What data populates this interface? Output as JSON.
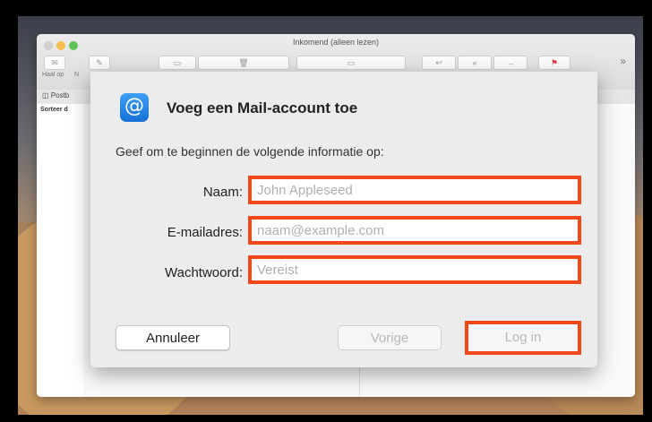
{
  "window": {
    "title": "Inkomend (alleen lezen)",
    "toolbar": {
      "get_mail_label": "Haal op",
      "new_label": "N",
      "mailboxes_label": "Postb",
      "sort_label": "Sorteer d",
      "more_label": "»"
    }
  },
  "dialog": {
    "title": "Voeg een Mail-account toe",
    "subtitle": "Geef om te beginnen de volgende informatie op:",
    "icon": "at-sign-icon",
    "fields": {
      "name": {
        "label": "Naam:",
        "placeholder": "John Appleseed",
        "value": ""
      },
      "email": {
        "label": "E-mailadres:",
        "placeholder": "naam@example.com",
        "value": ""
      },
      "password": {
        "label": "Wachtwoord:",
        "placeholder": "Vereist",
        "value": ""
      }
    },
    "buttons": {
      "cancel": "Annuleer",
      "previous": "Vorige",
      "login": "Log in"
    }
  },
  "colors": {
    "highlight": "#f04818",
    "accent": "#1670d8"
  }
}
